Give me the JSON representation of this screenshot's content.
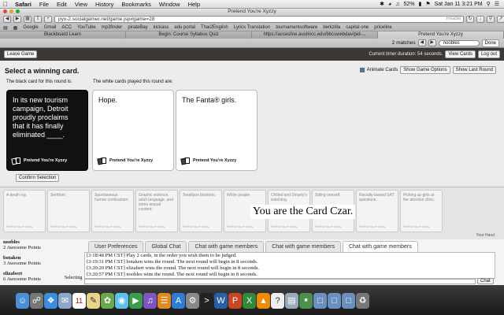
{
  "menubar": {
    "items": [
      "Safari",
      "File",
      "Edit",
      "View",
      "History",
      "Bookmarks",
      "Window",
      "Help"
    ],
    "battery": "52%",
    "clock": "Sat Jan 11  3:21 PM"
  },
  "browser": {
    "window_title": "Pretend You're Xyzzy",
    "url": "pyx-2.socialgamer.net/game.jsp#game=28",
    "reader": "Reader",
    "bookmarks": [
      "Google",
      "Gmail",
      "ACC",
      "YouTube",
      "mp3finder",
      "pirateBay",
      "kickass",
      "edu portal",
      "Thai2English",
      "Lyrics Translation",
      "tournamentsoftware",
      "berkzilla",
      "capital one",
      "priceline"
    ],
    "tabs": [
      {
        "label": "Blackboard Learn",
        "active": false
      },
      {
        "label": "Begin: Course Syllabus Quiz",
        "active": false
      },
      {
        "label": "https://accesline.austincc.edu/bbcswebdav/pid-...",
        "active": false
      },
      {
        "label": "Pretend You're Xyzzy",
        "active": true
      }
    ],
    "find": {
      "matches": "2 matches",
      "query": "noobles",
      "done": "Done"
    }
  },
  "page_header": {
    "leave_game": "Leave Game",
    "timer": "Current timer duration: 54 seconds.",
    "view_cards": "View Cards",
    "log_out": "Log out"
  },
  "game": {
    "title": "Select a winning card.",
    "animate_cards": "Animate Cards",
    "show_game_options": "Show Game Options",
    "show_last_round": "Show Last Round",
    "black_card_label": "The black card for this round is:",
    "white_cards_label": "The white cards played this round are:",
    "brand": "Pretend You're Xyzzy",
    "black_card": "In its new tourism campaign, Detroit proudly proclaims that it has finally eliminated ____.",
    "white_cards": [
      "Hope.",
      "The Fanta® girls."
    ],
    "confirm_selection": "Confirm Selection"
  },
  "hand": {
    "cards": [
      "A death ray.",
      "Serfdom.",
      "Spontaneous human combustion.",
      "Graphic violence, adult language, and some sexual content.",
      "Smallpox blankets.",
      "White people.",
      "Chilled and Smarty's watching.",
      "Stiling oneself.",
      "Racially-biased SAT questions.",
      "Picking up girls at the abortion clinic."
    ],
    "card_brand": "Pretend You're Xyzzy",
    "czar_message": "You are the Card Czar.",
    "your_hand": "Your Hand"
  },
  "scoreboard": {
    "players": [
      {
        "name": "noobles",
        "points": "2 Awesome Points"
      },
      {
        "name": "botaken",
        "points": "3 Awesome Points"
      },
      {
        "name": "elizabert",
        "points": "6 Awesome Points"
      }
    ],
    "status": "Selecting"
  },
  "chat": {
    "tabs": [
      {
        "label": "User Preferences",
        "active": false
      },
      {
        "label": "Global Chat",
        "active": false
      },
      {
        "label": "Chat with game members",
        "active": false
      },
      {
        "label": "Chat with game members",
        "active": false
      },
      {
        "label": "Chat with game members",
        "active": true
      }
    ],
    "log": [
      "[3:18:48 PM CST] Play 2 cards, in the order you wish them to be judged.",
      "[3:19:31 PM CST] botaken wins the round. The next round will begin in 8 seconds.",
      "[3:20:20 PM CST] elizabert wins the round. The next round will begin in 8 seconds.",
      "[3:20:57 PM CST] noobles wins the round. The next round will begin in 8 seconds."
    ],
    "send": "Chat"
  },
  "dock": {
    "icons": [
      "finder-icon",
      "launchpad-icon",
      "safari-icon",
      "mail-icon",
      "calendar-icon",
      "notes-icon",
      "photos-icon",
      "messages-icon",
      "facetime-icon",
      "itunes-icon",
      "ibooks-icon",
      "app-store-icon",
      "system-preferences-icon",
      "terminal-icon",
      "word-icon",
      "powerpoint-icon",
      "excel-icon",
      "vlc-icon",
      "help-icon",
      "preview-icon",
      "monitor-icon",
      "folder-icon",
      "folder-icon",
      "folder-icon",
      "trash-icon"
    ]
  }
}
